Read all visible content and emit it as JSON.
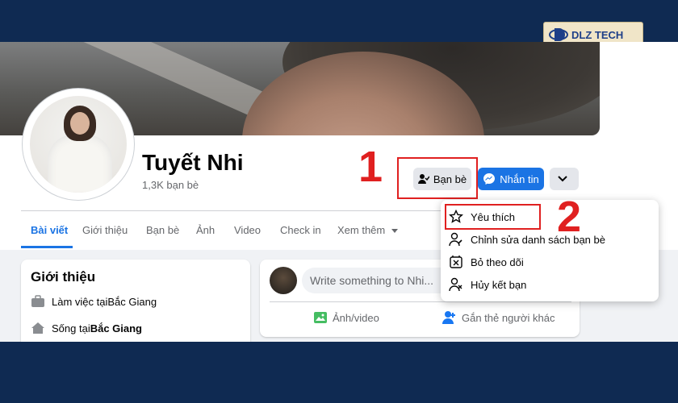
{
  "profile": {
    "name": "Tuyết Nhi",
    "friends_count": "1,3K bạn bè"
  },
  "actions": {
    "friends_label": "Bạn bè",
    "message_label": "Nhắn tin"
  },
  "annotations": {
    "step1": "1",
    "step2": "2"
  },
  "tabs": [
    {
      "label": "Bài viết"
    },
    {
      "label": "Giới thiệu"
    },
    {
      "label": "Bạn bè"
    },
    {
      "label": "Ảnh"
    },
    {
      "label": "Video"
    },
    {
      "label": "Check in"
    },
    {
      "label": "Xem thêm"
    }
  ],
  "intro": {
    "title": "Giới thiệu",
    "work_prefix": "Làm việc tại ",
    "work_place": "Bắc Giang",
    "live_prefix": "Sống tại ",
    "live_place": "Bắc Giang"
  },
  "composer": {
    "placeholder": "Write something to Nhi...",
    "photo_video": "Ảnh/video",
    "tag_people": "Gắn thẻ người khác"
  },
  "dropdown_menu": {
    "items": [
      {
        "label": "Yêu thích",
        "icon": "star-icon"
      },
      {
        "label": "Chỉnh sửa danh sách bạn bè",
        "icon": "person-edit-icon"
      },
      {
        "label": "Bỏ theo dõi",
        "icon": "unfollow-icon"
      },
      {
        "label": "Hủy kết bạn",
        "icon": "person-remove-icon"
      }
    ]
  },
  "watermark": {
    "brand": "DLZ TECH"
  },
  "colors": {
    "accent": "#1b74e4",
    "annotation": "#e02020",
    "frame": "#0f2a52"
  }
}
